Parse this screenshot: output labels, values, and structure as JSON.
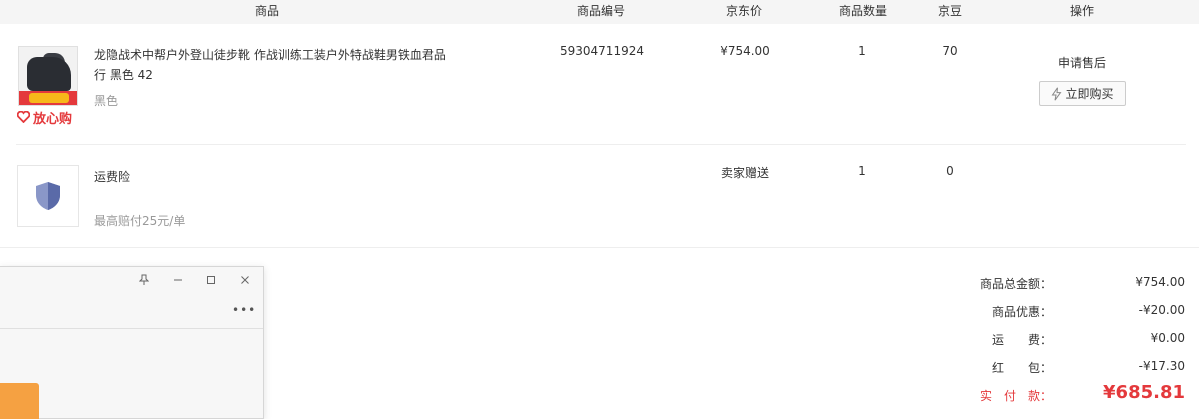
{
  "table_header": {
    "product": "商品",
    "sku": "商品编号",
    "price": "京东价",
    "quantity": "商品数量",
    "jingdou": "京豆",
    "actions": "操作"
  },
  "items": [
    {
      "name": "龙隐战术中帮户外登山徒步靴 作战训练工装户外特战鞋男铁血君品行 黑色 42",
      "color": "黑色",
      "badge": "放心购",
      "sku": "59304711924",
      "price": "¥754.00",
      "quantity": "1",
      "jingdou": "70",
      "after_sale_label": "申请售后",
      "buy_now_label": "立即购买"
    },
    {
      "name": "运费险",
      "description": "最高赔付25元/单",
      "price": "卖家赠送",
      "quantity": "1",
      "jingdou": "0"
    }
  ],
  "summary": [
    {
      "label": "商品总金额：",
      "value": "¥754.00"
    },
    {
      "label": "商品优惠：",
      "value": "-¥20.00"
    },
    {
      "label": "运　　费：",
      "value": "¥0.00"
    },
    {
      "label": "红　　包：",
      "value": "-¥17.30"
    },
    {
      "label": "实　付　款：",
      "value": "¥685.81"
    }
  ],
  "floating_window": {
    "more_label": "•••"
  },
  "colors": {
    "accent_red": "#e4393c",
    "header_bg": "#f5f5f5",
    "shield_blue": "#6a7ab8",
    "orange": "#f5a142"
  }
}
